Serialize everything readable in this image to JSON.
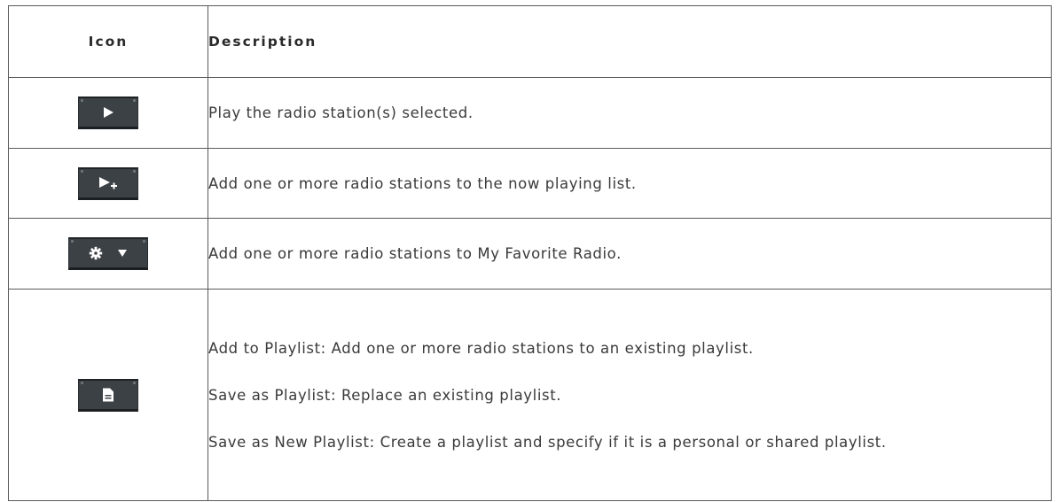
{
  "table": {
    "headers": {
      "icon": "Icon",
      "description": "Description"
    },
    "rows": [
      {
        "icon_name": "play-icon",
        "descriptions": [
          "Play the radio station(s) selected."
        ]
      },
      {
        "icon_name": "play-add-icon",
        "descriptions": [
          "Add one or more radio stations to the now playing list."
        ]
      },
      {
        "icon_name": "gear-dropdown-icon",
        "descriptions": [
          "Add one or more radio stations to My Favorite Radio."
        ]
      },
      {
        "icon_name": "playlist-document-icon",
        "descriptions": [
          "Add to Playlist: Add one or more radio stations to an existing playlist.",
          "Save as Playlist: Replace an existing playlist.",
          "Save as New Playlist: Create a playlist and specify if it is a personal or shared playlist."
        ]
      }
    ]
  }
}
